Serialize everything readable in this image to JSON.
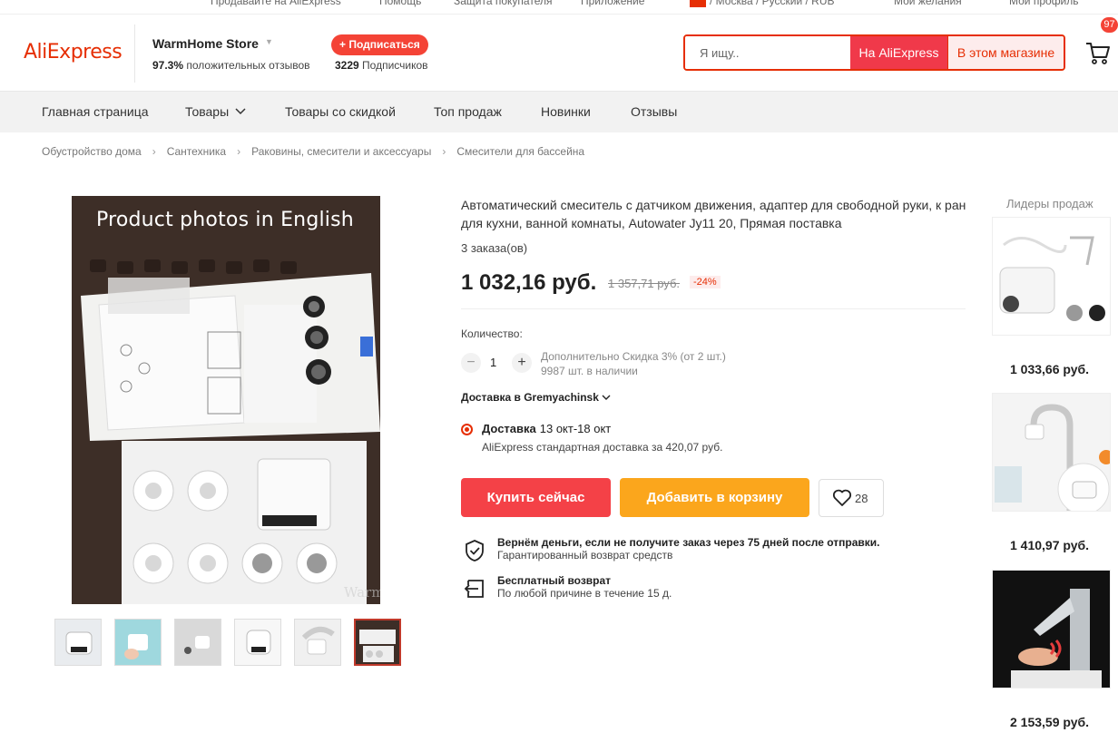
{
  "topbar": {
    "sell": "Продавайте на AliExpress",
    "help": "Помощь",
    "protection": "Защита покупателя",
    "app": "Приложение",
    "region": "/ Москва / Русский / RUB",
    "wishlist": "Мои желания",
    "profile": "Мой профиль"
  },
  "header": {
    "logo": "AliExpress",
    "store_name": "WarmHome Store",
    "rating_value": "97.3%",
    "rating_label": "положительных отзывов",
    "subscribe_label": "+ Подписаться",
    "subscribers_count": "3229",
    "subscribers_label": "Подписчиков",
    "search_placeholder": "Я ищу..",
    "search_aliexpress": "На AliExpress",
    "search_store": "В этом магазине",
    "cart_count": "97"
  },
  "nav": {
    "items": [
      "Главная страница",
      "Товары",
      "Товары со скидкой",
      "Топ продаж",
      "Новинки",
      "Отзывы"
    ]
  },
  "breadcrumb": [
    "Обустройство дома",
    "Сантехника",
    "Раковины, смесители и аксессуары",
    "Смесители для бассейна"
  ],
  "gallery": {
    "overlay_text": "Product photos in English",
    "watermark": "Warmhome",
    "thumbnail_count": 6,
    "active_thumbnail": 6
  },
  "product": {
    "title": "Автоматический смеситель с датчиком движения, адаптер для свободной руки, к ран для кухни, ванной комнаты, Autowater Jy11 20, Прямая поставка",
    "orders": "3 заказа(ов)",
    "price": "1 032,16 руб.",
    "old_price": "1 357,71 руб.",
    "discount": "-24%",
    "quantity_label": "Количество:",
    "quantity": "1",
    "extra_discount": "Дополнительно Скидка 3% (от 2 шт.)",
    "stock": "9987 шт. в наличии",
    "ship_to": "Доставка в Gremyachinsk",
    "delivery_label": "Доставка",
    "delivery_dates": "13 окт-18 окт",
    "delivery_method": "AliExpress стандартная доставка за 420,07 руб.",
    "buy_now": "Купить сейчас",
    "add_to_cart": "Добавить в корзину",
    "wishlist_count": "28",
    "guarantee_title": "Вернём деньги, если не получите заказ через 75 дней после отправки.",
    "guarantee_sub": "Гарантированный возврат средств",
    "return_title": "Бесплатный возврат",
    "return_sub": "По любой причине в течение 15 д."
  },
  "sidebar": {
    "title": "Лидеры продаж",
    "items": [
      {
        "price": "1 033,66 руб."
      },
      {
        "price": "1 410,97 руб."
      },
      {
        "price": "2 153,59 руб."
      }
    ]
  },
  "colors": {
    "brand": "#e62e04",
    "buy": "#f44147",
    "cart": "#fba61c"
  }
}
